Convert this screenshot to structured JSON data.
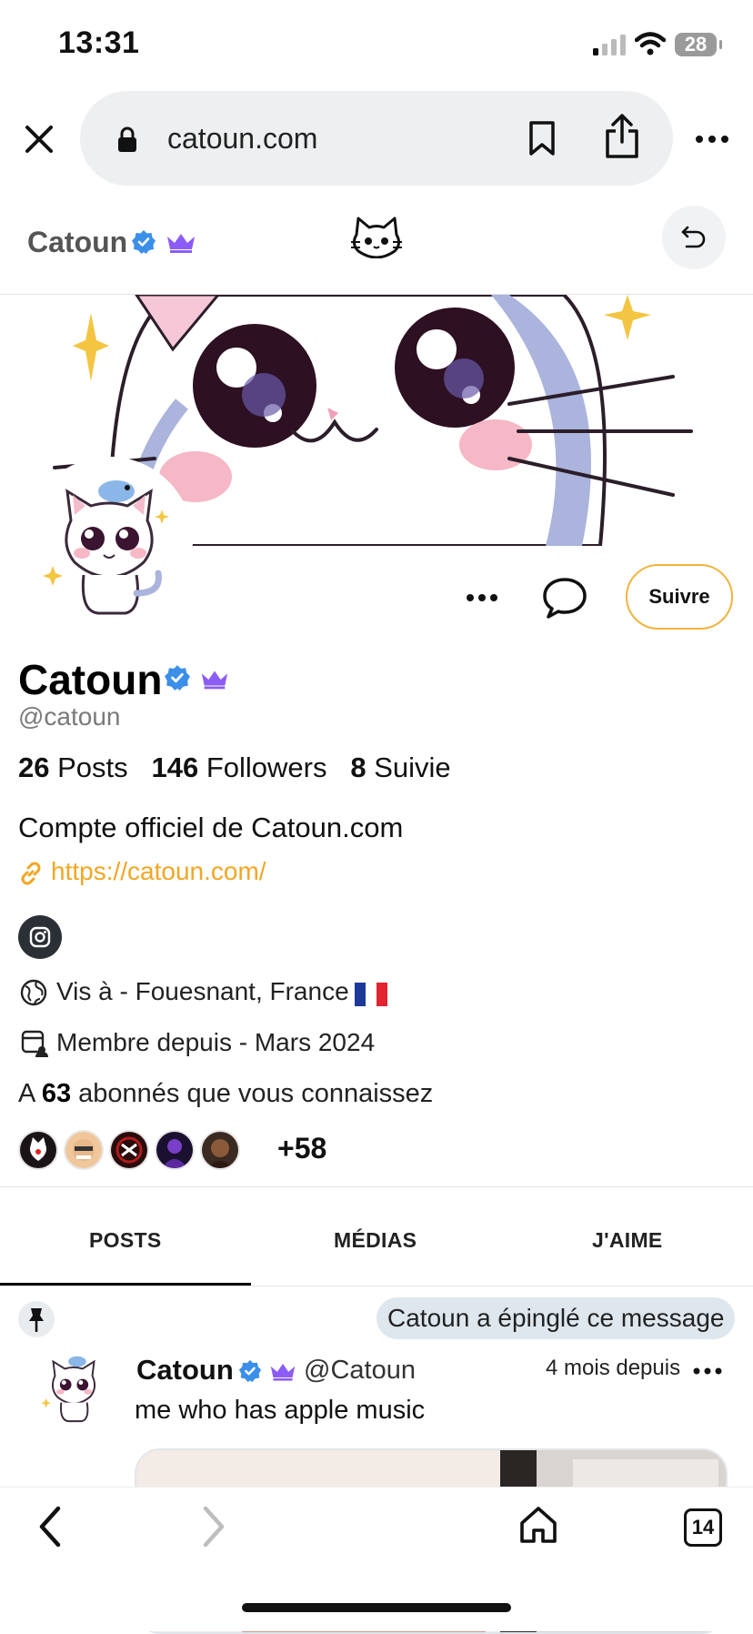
{
  "status_bar": {
    "time": "13:31",
    "battery": "28"
  },
  "browser": {
    "url": "catoun.com",
    "tab_count": "14"
  },
  "site_header": {
    "name": "Catoun"
  },
  "profile": {
    "name": "Catoun",
    "handle": "@catoun",
    "follow_label": "Suivre",
    "stats": [
      {
        "value": "26",
        "label": "Posts"
      },
      {
        "value": "146",
        "label": "Followers"
      },
      {
        "value": "8",
        "label": "Suivie"
      }
    ],
    "bio": "Compte officiel de Catoun.com",
    "link": "https://catoun.com/",
    "location": "Vis à - Fouesnant, France",
    "member_since": "Membre depuis - Mars 2024",
    "mutual_prefix": "A",
    "mutual_count": "63",
    "mutual_suffix": "abonnés que vous connaissez",
    "mutual_more": "+58"
  },
  "tabs": [
    {
      "label": "POSTS",
      "active": true
    },
    {
      "label": "MÉDIAS",
      "active": false
    },
    {
      "label": "J'AIME",
      "active": false
    }
  ],
  "post": {
    "pinned_label": "Catoun a épinglé ce message",
    "author": "Catoun",
    "handle": "@Catoun",
    "time": "4 mois depuis",
    "text": "me who has apple music"
  },
  "colors": {
    "accent": "#f2a623",
    "verified": "#3b8fe8",
    "premium": "#8b5cf6",
    "pin_bg": "#dfe7ee"
  }
}
